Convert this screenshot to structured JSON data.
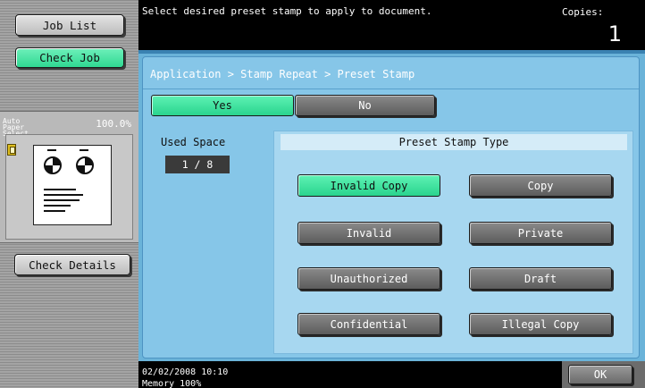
{
  "left_panel": {
    "job_list_label": "Job List",
    "check_job_label": "Check Job",
    "paper_select_label": "Auto Paper Select",
    "zoom_value": "100.0%",
    "check_details_label": "Check Details"
  },
  "message_bar": {
    "message": "Select desired preset stamp to apply to document.",
    "copies_label": "Copies:",
    "copies_value": "1"
  },
  "main": {
    "breadcrumb": "Application > Stamp Repeat > Preset Stamp",
    "yes_label": "Yes",
    "no_label": "No",
    "selected_toggle": "Yes",
    "used_space_label": "Used Space",
    "used_space_value": "1 / 8",
    "preset_type_title": "Preset Stamp Type",
    "stamp_types": [
      {
        "label": "Invalid Copy",
        "selected": true
      },
      {
        "label": "Copy",
        "selected": false
      },
      {
        "label": "Invalid",
        "selected": false
      },
      {
        "label": "Private",
        "selected": false
      },
      {
        "label": "Unauthorized",
        "selected": false
      },
      {
        "label": "Draft",
        "selected": false
      },
      {
        "label": "Confidential",
        "selected": false
      },
      {
        "label": "Illegal Copy",
        "selected": false
      }
    ]
  },
  "status_bar": {
    "datetime": "02/02/2008   10:10",
    "memory": "Memory      100%",
    "ok_label": "OK"
  },
  "colors": {
    "selected_green": "#2fd892",
    "panel_blue": "#86c6e8",
    "button_dark": "#6a6a6a"
  }
}
